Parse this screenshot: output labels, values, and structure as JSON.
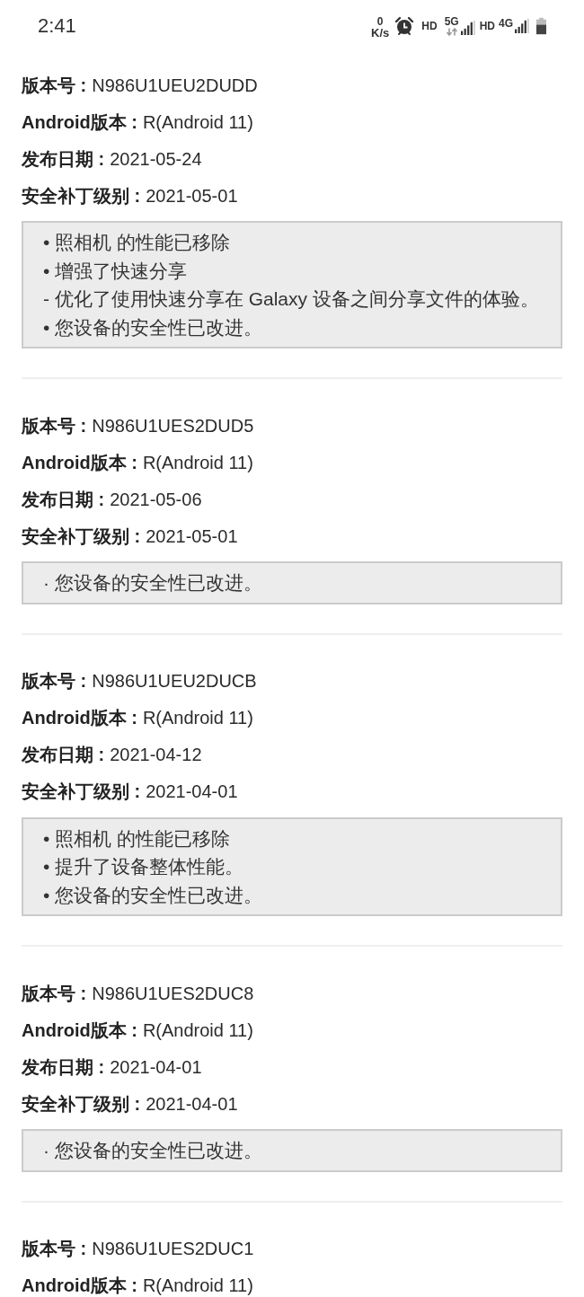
{
  "status_bar": {
    "time": "2:41",
    "speed": {
      "value": "0",
      "unit": "K/s"
    },
    "networks": [
      {
        "hd": "HD",
        "type": "5G",
        "arrows": true
      },
      {
        "hd": "HD",
        "type": "4G"
      }
    ]
  },
  "releases": [
    {
      "fields": [
        {
          "label": "版本号 :",
          "value": "N986U1UEU2DUDD"
        },
        {
          "label": "Android版本 :",
          "value": "R(Android 11)"
        },
        {
          "label": "发布日期 :",
          "value": "2021-05-24"
        },
        {
          "label": "安全补丁级别 :",
          "value": "2021-05-01"
        }
      ],
      "notes": [
        "• 照相机 的性能已移除",
        "• 增强了快速分享",
        "- 优化了使用快速分享在 Galaxy 设备之间分享文件的体验。",
        "• 您设备的安全性已改进。"
      ]
    },
    {
      "fields": [
        {
          "label": "版本号 :",
          "value": "N986U1UES2DUD5"
        },
        {
          "label": "Android版本 :",
          "value": "R(Android 11)"
        },
        {
          "label": "发布日期 :",
          "value": "2021-05-06"
        },
        {
          "label": "安全补丁级别 :",
          "value": "2021-05-01"
        }
      ],
      "notes": [
        "· 您设备的安全性已改进。"
      ]
    },
    {
      "fields": [
        {
          "label": "版本号 :",
          "value": "N986U1UEU2DUCB"
        },
        {
          "label": "Android版本 :",
          "value": "R(Android 11)"
        },
        {
          "label": "发布日期 :",
          "value": "2021-04-12"
        },
        {
          "label": "安全补丁级别 :",
          "value": "2021-04-01"
        }
      ],
      "notes": [
        "• 照相机 的性能已移除",
        "• 提升了设备整体性能。",
        "• 您设备的安全性已改进。"
      ]
    },
    {
      "fields": [
        {
          "label": "版本号 :",
          "value": "N986U1UES2DUC8"
        },
        {
          "label": "Android版本 :",
          "value": "R(Android 11)"
        },
        {
          "label": "发布日期 :",
          "value": "2021-04-01"
        },
        {
          "label": "安全补丁级别 :",
          "value": "2021-04-01"
        }
      ],
      "notes": [
        "· 您设备的安全性已改进。"
      ]
    },
    {
      "fields": [
        {
          "label": "版本号 :",
          "value": "N986U1UES2DUC1"
        },
        {
          "label": "Android版本 :",
          "value": "R(Android 11)"
        }
      ]
    }
  ]
}
